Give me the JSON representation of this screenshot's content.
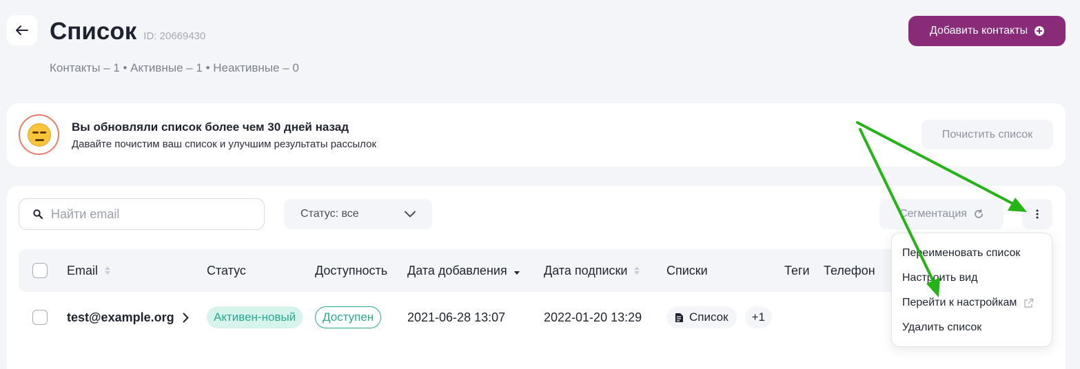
{
  "header": {
    "title": "Список",
    "id_label": "ID: 20669430",
    "stats": "Контакты – 1 • Активные – 1 • Неактивные – 0",
    "add_button": "Добавить контакты"
  },
  "banner": {
    "title": "Вы обновляли список более чем 30 дней назад",
    "subtitle": "Давайте почистим ваш список и улучшим результаты рассылок",
    "clean_button": "Почистить список"
  },
  "toolbar": {
    "search_placeholder": "Найти email",
    "status_filter": "Статус: все",
    "segmentation": "Сегментация"
  },
  "table": {
    "columns": [
      "Email",
      "Статус",
      "Доступность",
      "Дата добавления",
      "Дата подписки",
      "Списки",
      "Теги",
      "Телефон"
    ],
    "rows": [
      {
        "email": "test@example.org",
        "status": "Активен-новый",
        "availability": "Доступен",
        "date_added": "2021-06-28 13:07",
        "date_subscribed": "2022-01-20 13:29",
        "list": "Список",
        "more_lists": "+1"
      }
    ]
  },
  "menu": {
    "items": [
      "Переименовать список",
      "Настроить вид",
      "Перейти к настройкам",
      "Удалить список"
    ]
  },
  "colors": {
    "accent": "#8a2b7a",
    "status_green": "#27a98b",
    "annotation_arrow": "#22b514"
  }
}
